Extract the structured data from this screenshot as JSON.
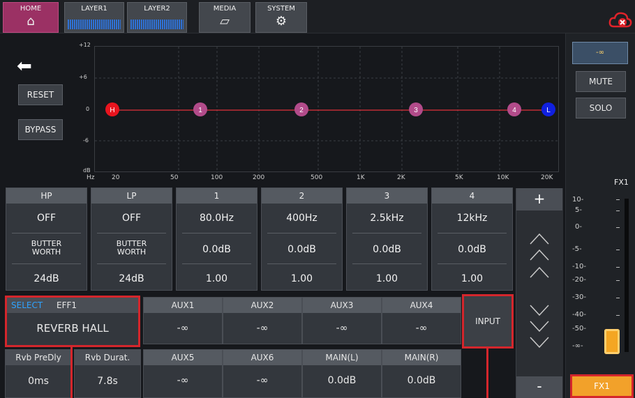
{
  "nav": {
    "home": "HOME",
    "layer1": "LAYER1",
    "layer2": "LAYER2",
    "media": "MEDIA",
    "system": "SYSTEM"
  },
  "tools": {
    "reset": "RESET",
    "bypass": "BYPASS"
  },
  "graph": {
    "y_labels": [
      "+12",
      "+6",
      "0",
      "-6",
      "dB"
    ],
    "x_labels": [
      "Hz",
      "20",
      "50",
      "100",
      "200",
      "500",
      "1K",
      "2K",
      "5K",
      "10K",
      "20K"
    ],
    "nodes": [
      "H",
      "1",
      "2",
      "3",
      "4",
      "L"
    ]
  },
  "bands": [
    {
      "head": "HP",
      "freq": "OFF",
      "type": "BUTTER\nWORTH",
      "val": "24dB"
    },
    {
      "head": "LP",
      "freq": "OFF",
      "type": "BUTTER\nWORTH",
      "val": "24dB"
    },
    {
      "head": "1",
      "freq": "80.0Hz",
      "gain": "0.0dB",
      "q": "1.00"
    },
    {
      "head": "2",
      "freq": "400Hz",
      "gain": "0.0dB",
      "q": "1.00"
    },
    {
      "head": "3",
      "freq": "2.5kHz",
      "gain": "0.0dB",
      "q": "1.00"
    },
    {
      "head": "4",
      "freq": "12kHz",
      "gain": "0.0dB",
      "q": "1.00"
    }
  ],
  "side": {
    "plus": "+",
    "minus": "-"
  },
  "effect": {
    "select": "SELECT",
    "slot": "EFF1",
    "name": "REVERB HALL"
  },
  "sends": [
    {
      "head": "AUX1",
      "val": "-∞"
    },
    {
      "head": "AUX2",
      "val": "-∞"
    },
    {
      "head": "AUX3",
      "val": "-∞"
    },
    {
      "head": "AUX4",
      "val": "-∞"
    },
    {
      "head": "AUX5",
      "val": "-∞"
    },
    {
      "head": "AUX6",
      "val": "-∞"
    },
    {
      "head": "MAIN(L)",
      "val": "0.0dB"
    },
    {
      "head": "MAIN(R)",
      "val": "0.0dB"
    }
  ],
  "params": [
    {
      "head": "Rvb PreDly",
      "val": "0ms"
    },
    {
      "head": "Rvb Durat.",
      "val": "7.8s"
    }
  ],
  "input_btn": "INPUT",
  "meter": {
    "display": "-∞",
    "mute": "MUTE",
    "solo": "SOLO",
    "channel": "FX1",
    "scale": [
      "10-",
      "5-",
      "0-",
      "-5-",
      "-10-",
      "-20-",
      "-30-",
      "-40-",
      "-50-",
      "-∞-"
    ],
    "fx_button": "FX1"
  },
  "colors": {
    "accent_red": "#d4262c",
    "highlight_orange": "#f2a12a",
    "home_active": "#9b3164"
  }
}
